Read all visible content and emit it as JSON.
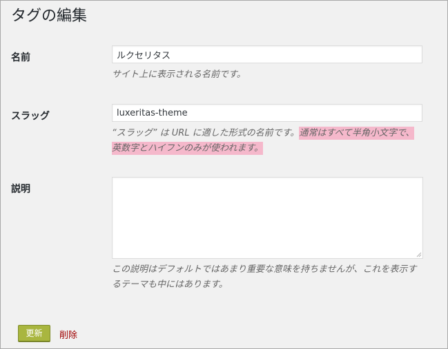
{
  "page": {
    "title": "タグの編集"
  },
  "fields": {
    "name": {
      "label": "名前",
      "value": "ルクセリタス",
      "description": "サイト上に表示される名前です。"
    },
    "slug": {
      "label": "スラッグ",
      "value": "luxeritas-theme",
      "description_plain": "“スラッグ” は URL に適した形式の名前です。",
      "description_highlight_1": "通常はすべて半角小文字で、",
      "description_highlight_2": "英数字とハイフンのみが使われます。"
    },
    "description": {
      "label": "説明",
      "value": "",
      "help_line1": "この説明はデフォルトではあまり重要な意味を持ちませんが、これを表示す",
      "help_line2": "るテーマも中にはあります。"
    }
  },
  "actions": {
    "update_label": "更新",
    "delete_label": "削除"
  },
  "colors": {
    "highlight": "#f5b8cb",
    "button": "#a9b63f",
    "delete_link": "#a00000"
  }
}
